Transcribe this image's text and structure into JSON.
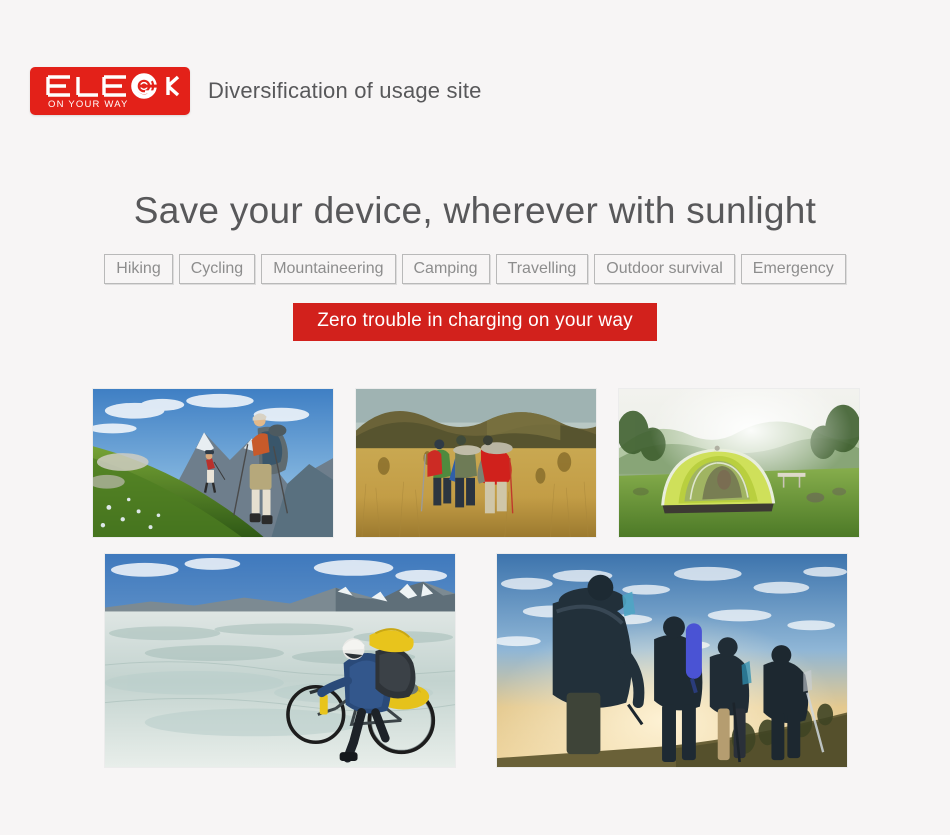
{
  "page": {
    "background_color": "#f7f5f5",
    "text_color": "#58585a"
  },
  "header": {
    "logo": {
      "brand": "ELEGEEK",
      "tagline": "ON YOUR WAY",
      "background_color": "#e32119",
      "icon": "elegeek-circle-logo-icon"
    },
    "title": "Diversification of usage site"
  },
  "headline": "Save your device, wherever with sunlight",
  "tags": [
    {
      "label": "Hiking"
    },
    {
      "label": "Cycling"
    },
    {
      "label": "Mountaineering"
    },
    {
      "label": "Camping"
    },
    {
      "label": "Travelling"
    },
    {
      "label": "Outdoor survival"
    },
    {
      "label": "Emergency"
    }
  ],
  "banner": {
    "text": "Zero trouble in charging on your way",
    "background_color": "#d2211c",
    "text_color": "#ffffff"
  },
  "gallery": {
    "top_row": [
      {
        "name": "photo-hiking-alpine-slope",
        "alt": "Two hikers with backpacks climbing a green flowering alpine slope under a blue sky with mountains"
      },
      {
        "name": "photo-trekking-grassland",
        "alt": "Three trekkers with red and green backpacks walking through golden grassland with rolling brown hills"
      },
      {
        "name": "photo-camping-tent",
        "alt": "Yellow-green dome tent pitched on a grassy field with hazy forested hills and sunlight behind"
      }
    ],
    "bottom_row": [
      {
        "name": "photo-cycling-glacier",
        "alt": "Cyclist in a blue jacket with yellow panniers riding across an icy glacial plain with snowy mountains"
      },
      {
        "name": "photo-backpackers-sunset",
        "alt": "Four backpackers silhouetted walking along a ridge against a bright sunset sky with clouds"
      }
    ]
  }
}
